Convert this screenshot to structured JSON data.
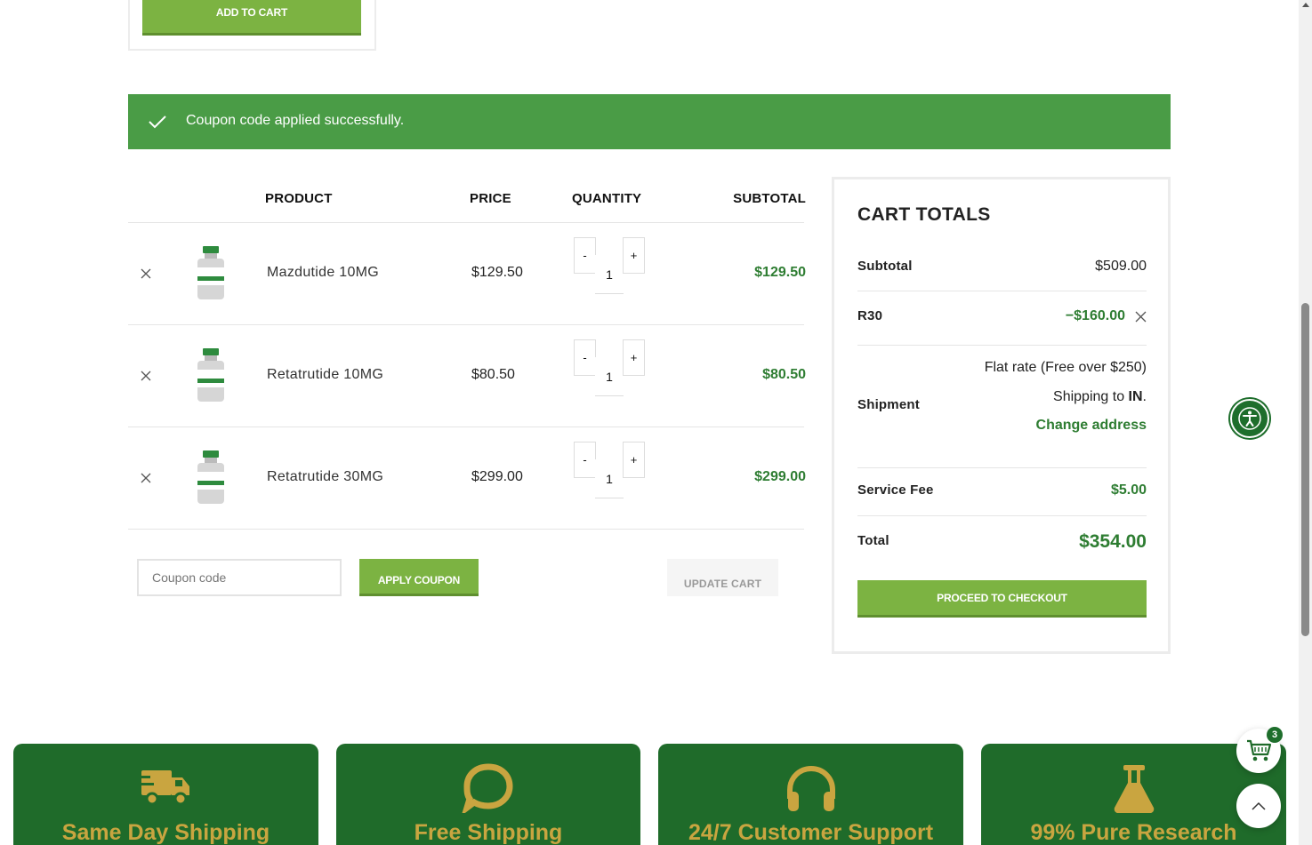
{
  "top_card": {
    "add_to_cart_label": "ADD TO CART"
  },
  "notice": {
    "message": "Coupon code applied successfully."
  },
  "table": {
    "headers": {
      "product": "PRODUCT",
      "price": "PRICE",
      "quantity": "QUANTITY",
      "subtotal": "SUBTOTAL"
    },
    "rows": [
      {
        "name": "Mazdutide 10MG",
        "price": "$129.50",
        "qty": "1",
        "subtotal": "$129.50"
      },
      {
        "name": "Retatrutide 10MG",
        "price": "$80.50",
        "qty": "1",
        "subtotal": "$80.50"
      },
      {
        "name": "Retatrutide 30MG",
        "price": "$299.00",
        "qty": "1",
        "subtotal": "$299.00"
      }
    ],
    "minus_label": "-",
    "plus_label": "+"
  },
  "actions": {
    "coupon_placeholder": "Coupon code",
    "apply_coupon_label": "APPLY COUPON",
    "update_cart_label": "UPDATE CART"
  },
  "totals": {
    "title": "CART TOTALS",
    "subtotal_label": "Subtotal",
    "subtotal_value": "$509.00",
    "coupon_label": "R30",
    "coupon_value": "−$160.00",
    "shipment_label": "Shipment",
    "shipping_method": "Flat rate (Free over $250)",
    "shipping_to_prefix": "Shipping to ",
    "shipping_to_country": "IN",
    "shipping_to_suffix": ".",
    "change_address_label": "Change address",
    "service_fee_label": "Service Fee",
    "service_fee_value": "$5.00",
    "total_label": "Total",
    "total_value": "$354.00",
    "checkout_label": "PROCEED TO CHECKOUT"
  },
  "floating": {
    "cart_count": "3"
  },
  "features": [
    {
      "title": "Same Day Shipping",
      "icon": "shipping-truck-icon"
    },
    {
      "title": "Free Shipping",
      "icon": "chat-bubble-icon"
    },
    {
      "title": "24/7 Customer Support",
      "icon": "headphones-icon"
    },
    {
      "title": "99% Pure Research",
      "icon": "flask-icon"
    }
  ],
  "colors": {
    "brand_green": "#7cb342",
    "dark_green": "#1f6b2a",
    "notice_green": "#4a9c46",
    "price_green": "#2e7d32",
    "gold": "#c9a540"
  }
}
